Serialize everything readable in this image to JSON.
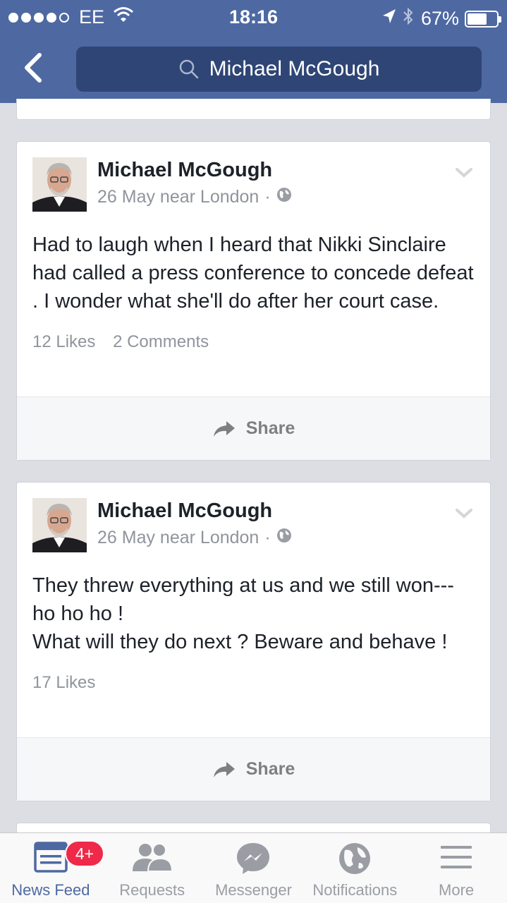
{
  "status_bar": {
    "carrier": "EE",
    "time": "18:16",
    "battery": "67%",
    "battery_level": 0.67
  },
  "header": {
    "search_value": "Michael McGough"
  },
  "posts": [
    {
      "author": "Michael McGough",
      "date_location": "26 May near London",
      "separator": "·",
      "text": "Had to laugh when I heard that Nikki Sinclaire had called a press conference to concede defeat . I wonder what she'll do after her court case.",
      "likes": "12 Likes",
      "comments": "2 Comments",
      "share_label": "Share"
    },
    {
      "author": "Michael McGough",
      "date_location": "26 May near London",
      "separator": "·",
      "text_lines": [
        "They threw everything at us and we still won--- ho ho ho !",
        "What will they do next ? Beware and behave !"
      ],
      "likes": "17 Likes",
      "share_label": "Share"
    }
  ],
  "tab_bar": {
    "tabs": [
      {
        "label": "News Feed",
        "icon": "news-feed-icon",
        "active": true
      },
      {
        "label": "Requests",
        "icon": "friend-requests-icon"
      },
      {
        "label": "Messenger",
        "icon": "messenger-icon"
      },
      {
        "label": "Notifications",
        "icon": "globe-icon"
      },
      {
        "label": "More",
        "icon": "menu-icon"
      }
    ],
    "news_feed_badge": "4+"
  },
  "colors": {
    "brand": "#4e69a2",
    "search_bg": "#2f4575",
    "badge": "#f02849"
  }
}
